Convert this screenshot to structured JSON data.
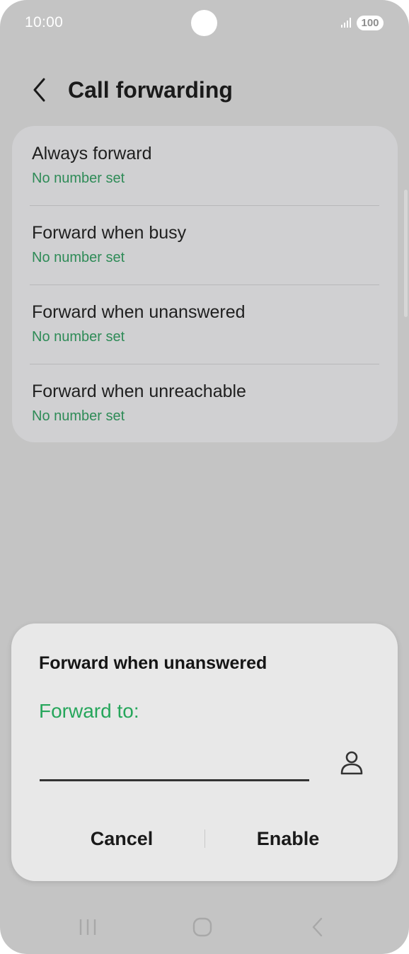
{
  "status_bar": {
    "time": "10:00",
    "battery": "100",
    "icons": [
      "signal-icon",
      "battery-icon"
    ]
  },
  "header": {
    "title": "Call forwarding",
    "back_icon": "back-arrow-icon"
  },
  "forwarding_options": [
    {
      "title": "Always forward",
      "subtitle": "No number set"
    },
    {
      "title": "Forward when busy",
      "subtitle": "No number set"
    },
    {
      "title": "Forward when unanswered",
      "subtitle": "No number set"
    },
    {
      "title": "Forward when unreachable",
      "subtitle": "No number set"
    }
  ],
  "dialog": {
    "title": "Forward when unanswered",
    "forward_label": "Forward to:",
    "number_value": "",
    "contact_icon": "contact-person-icon",
    "cancel_label": "Cancel",
    "enable_label": "Enable"
  },
  "navigation_bar": {
    "icons": [
      "recents-icon",
      "home-icon",
      "back-icon"
    ]
  },
  "colors": {
    "background": "#c4c4c4",
    "card": "#d0d0d2",
    "dialog": "#e8e8e8",
    "subtitle_green": "#2e8b57",
    "accent_green": "#26a65b"
  }
}
